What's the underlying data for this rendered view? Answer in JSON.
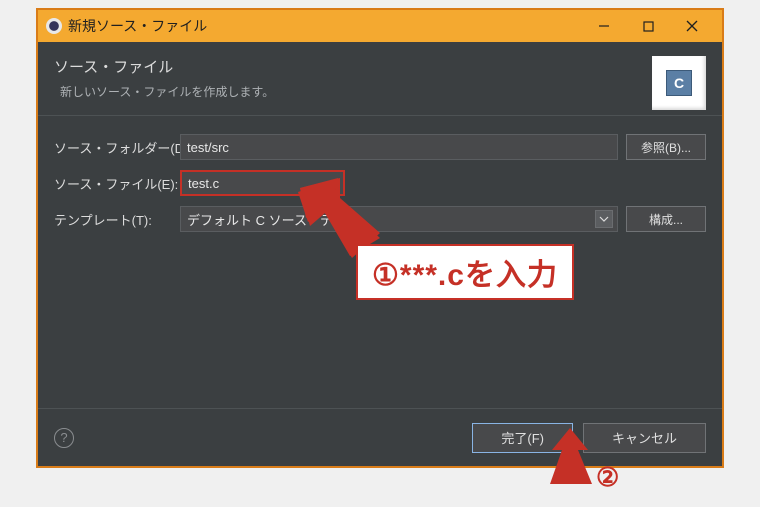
{
  "window": {
    "title": "新規ソース・ファイル"
  },
  "header": {
    "title": "ソース・ファイル",
    "subtitle": "新しいソース・ファイルを作成します。"
  },
  "badge": {
    "letter": "C"
  },
  "form": {
    "folder_label": "ソース・フォルダー(D):",
    "folder_value": "test/src",
    "browse_label": "参照(B)...",
    "file_label": "ソース・ファイル(E):",
    "file_value": "test.c",
    "template_label": "テンプレート(T):",
    "template_value": "デフォルト C ソース・テンプ",
    "configure_label": "構成..."
  },
  "footer": {
    "help_glyph": "?",
    "finish_label": "完了(F)",
    "cancel_label": "キャンセル"
  },
  "annotations": {
    "step1": "①***.cを入力",
    "step2": "②"
  }
}
